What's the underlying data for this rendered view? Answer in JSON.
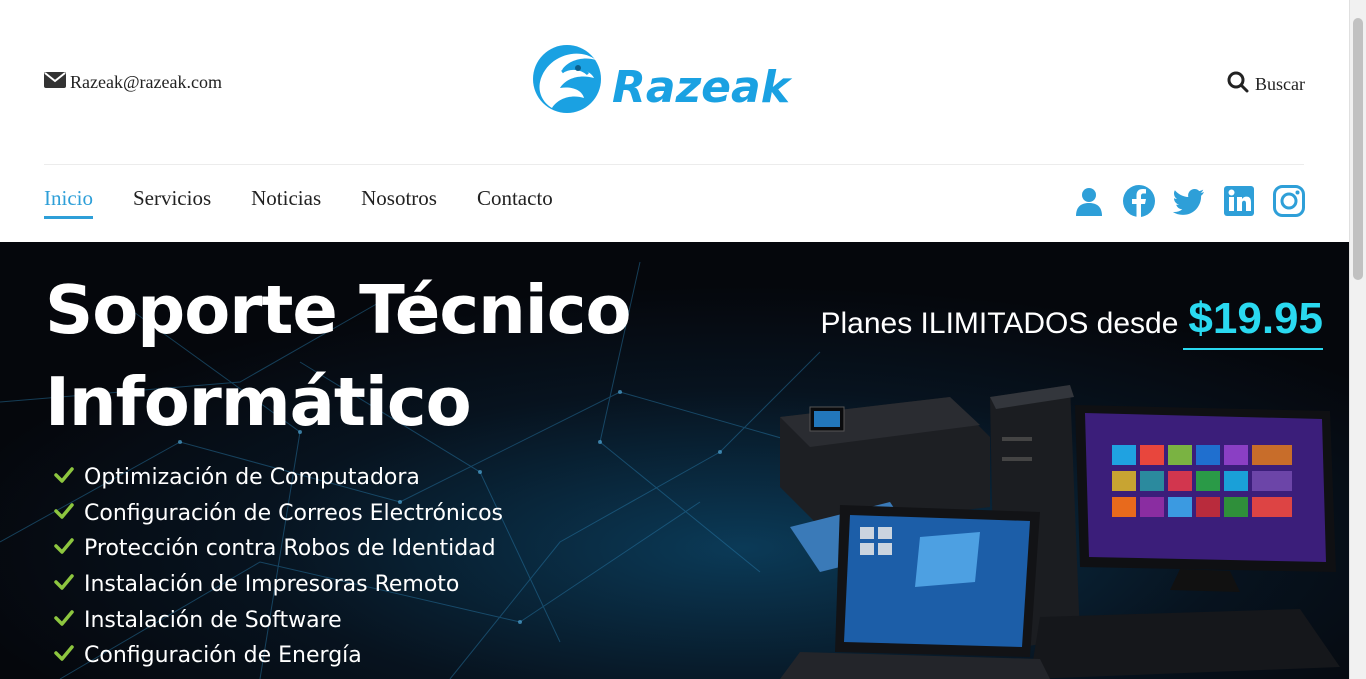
{
  "header": {
    "email": "Razeak@razeak.com",
    "logo_text": "Razeak",
    "search_label": "Buscar"
  },
  "nav": {
    "items": [
      {
        "label": "Inicio",
        "active": true
      },
      {
        "label": "Servicios"
      },
      {
        "label": "Noticias"
      },
      {
        "label": "Nosotros"
      },
      {
        "label": "Contacto"
      }
    ]
  },
  "social": [
    "user-icon",
    "facebook-icon",
    "twitter-icon",
    "linkedin-icon",
    "instagram-icon"
  ],
  "colors": {
    "brand": "#2e9fd8",
    "price": "#2ad9f0",
    "check": "#8dc63f",
    "hero_bg": "#05070c"
  },
  "hero": {
    "title_line1": "Soporte Técnico",
    "title_line2": "Informático",
    "planes_text": "Planes ILIMITADOS desde",
    "price": "$19.95",
    "features": [
      "Optimización de Computadora",
      "Configuración de Correos Electrónicos",
      "Protección contra Robos de Identidad",
      "Instalación de Impresoras Remoto",
      "Instalación de Software",
      "Configuración de Energía"
    ]
  }
}
